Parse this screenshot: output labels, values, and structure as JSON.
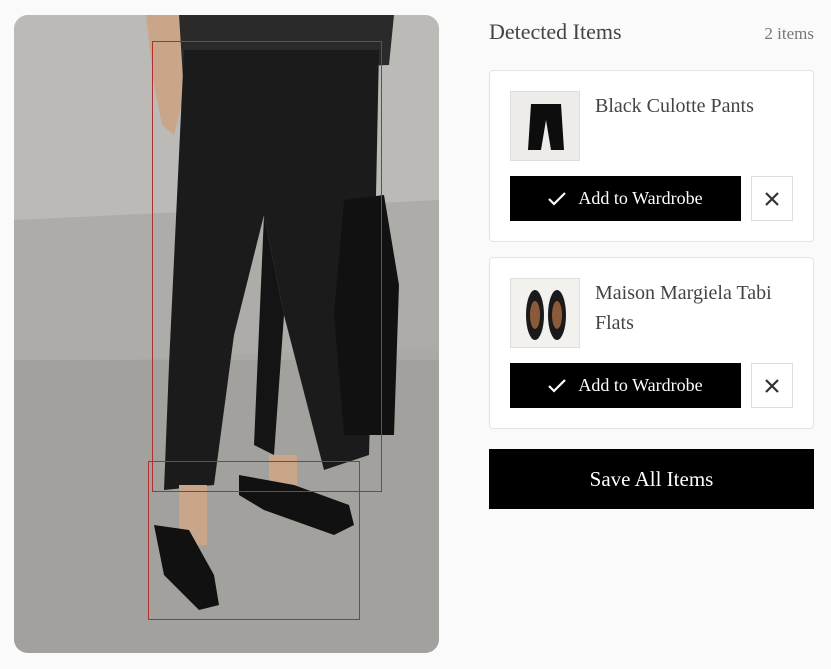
{
  "panel": {
    "title": "Detected Items",
    "count": "2 items"
  },
  "items": [
    {
      "name": "Black Culotte Pants",
      "add_label": "Add to Wardrobe",
      "thumbnail_icon": "pants-icon"
    },
    {
      "name": "Maison Margiela Tabi Flats",
      "add_label": "Add to Wardrobe",
      "thumbnail_icon": "shoes-icon"
    }
  ],
  "actions": {
    "save_all_label": "Save All Items"
  },
  "colors": {
    "accent": "#000000",
    "detection_box": "#b03030",
    "background": "#fafafa"
  }
}
